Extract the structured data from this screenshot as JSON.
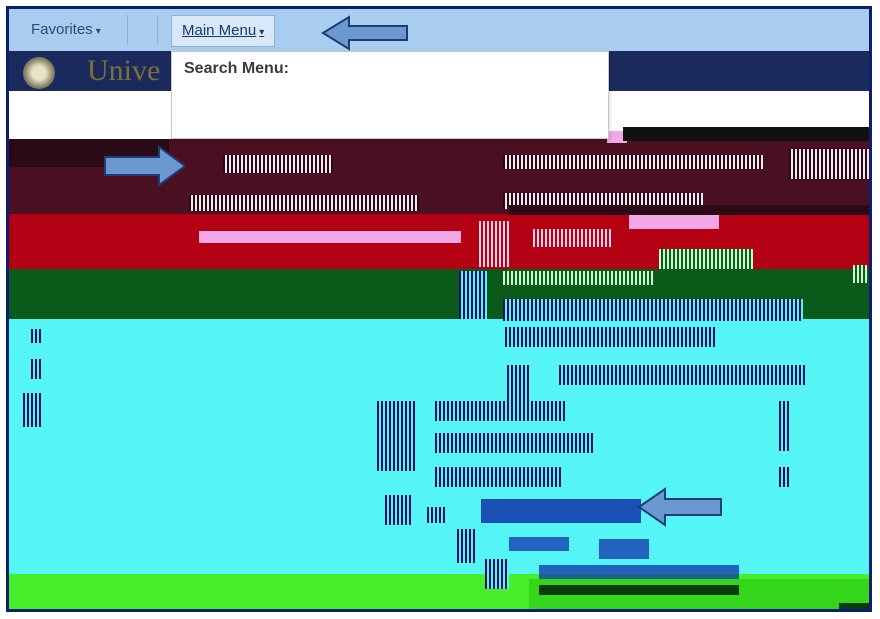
{
  "navbar": {
    "favorites_label": "Favorites",
    "main_menu_label": "Main Menu",
    "caret": "▾"
  },
  "dropdown": {
    "search_label": "Search Menu:"
  },
  "icons": {
    "caret": "chevron-down-icon",
    "pointer_arrows": "arrow-icon"
  },
  "colors": {
    "navbar": "#a9cdee",
    "header": "#1b2a5c",
    "arrow_fill": "#6a98cf",
    "arrow_stroke": "#1b3d7a"
  }
}
